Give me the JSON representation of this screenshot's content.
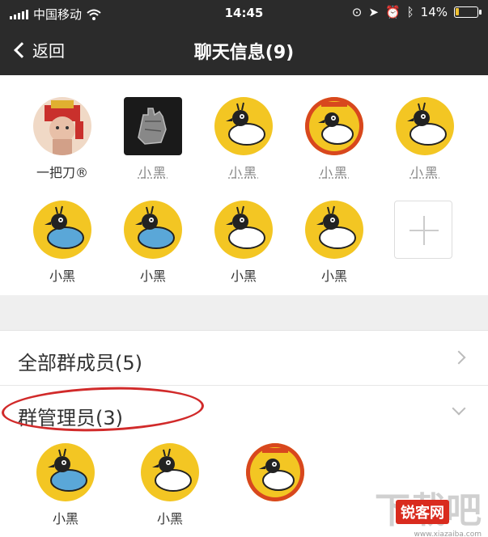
{
  "status": {
    "carrier": "中国移动",
    "time": "14:45",
    "battery": "14%",
    "battery_level": 0.14
  },
  "nav": {
    "back_label": "返回",
    "title": "聊天信息(9)"
  },
  "members": [
    {
      "name": "一把刀®",
      "icon": "fortune-god-avatar"
    },
    {
      "name": "小黑",
      "icon": "glove-photo-avatar",
      "obscured": true
    },
    {
      "name": "小黑",
      "icon": "crow-white-avatar",
      "obscured": true
    },
    {
      "name": "小黑",
      "icon": "crow-ring-avatar",
      "obscured": true
    },
    {
      "name": "小黑",
      "icon": "crow-white-avatar",
      "obscured": true
    },
    {
      "name": "小黑",
      "icon": "crow-blue-avatar"
    },
    {
      "name": "小黑",
      "icon": "crow-blue-avatar"
    },
    {
      "name": "小黑",
      "icon": "crow-white-avatar"
    },
    {
      "name": "小黑",
      "icon": "crow-white-avatar"
    }
  ],
  "sections": {
    "all_members": "全部群成员(5)",
    "admins": "群管理员(3)"
  },
  "admins": [
    {
      "name": "小黑",
      "icon": "crow-blue-avatar"
    },
    {
      "name": "小黑",
      "icon": "crow-white-avatar"
    },
    {
      "name": "",
      "icon": "crow-ring-avatar"
    }
  ],
  "watermark": {
    "text": "下载吧",
    "badge": "锐客网",
    "url": "www.xiazaiba.com"
  },
  "colors": {
    "nav_bg": "#2b2b2b",
    "avatar_yellow": "#f3c623",
    "highlight_oval": "#d12a2a"
  }
}
